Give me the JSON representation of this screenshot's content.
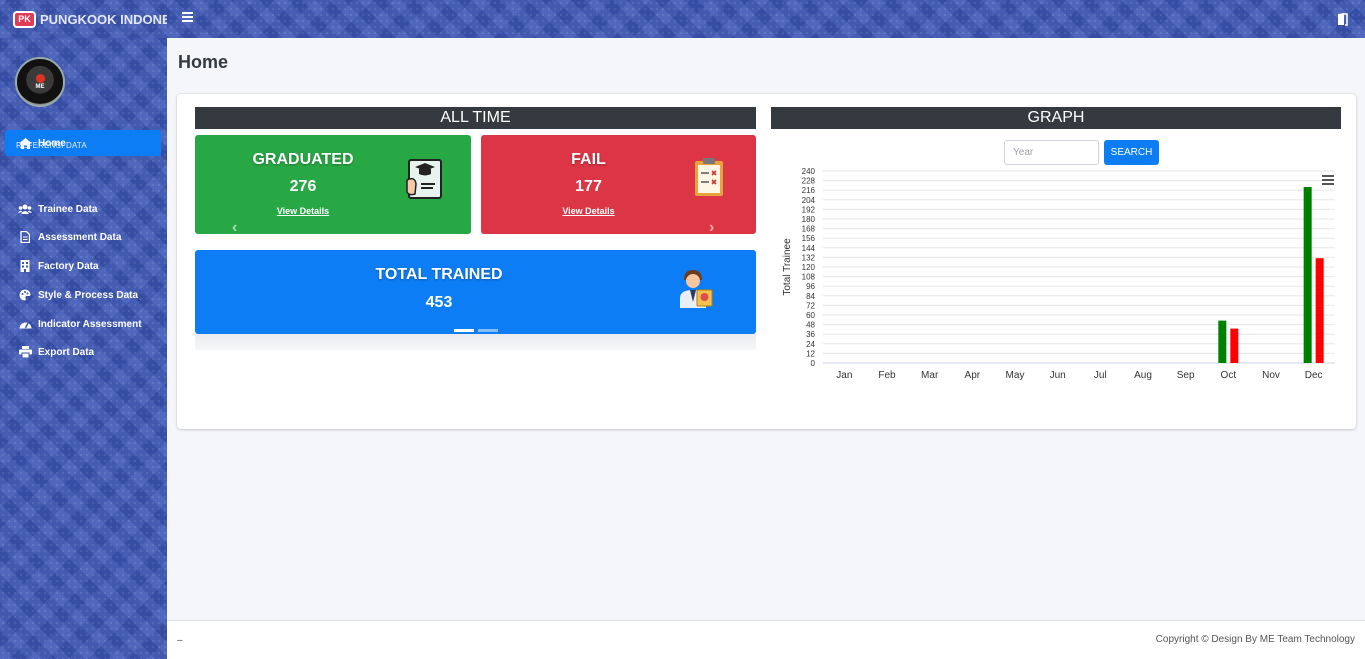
{
  "brand": {
    "logo_text": "PK",
    "name": "PUNGKOOK INDONESIA"
  },
  "avatar": {
    "text": "ME"
  },
  "sidebar": {
    "home_label": "Home",
    "section_header": "REFERENSI DATA",
    "items": [
      {
        "label": "Trainee Data",
        "icon": "users-icon"
      },
      {
        "label": "Assessment Data",
        "icon": "file-icon"
      },
      {
        "label": "Factory Data",
        "icon": "building-icon"
      },
      {
        "label": "Style & Process Data",
        "icon": "palette-icon"
      },
      {
        "label": "Indicator Assessment",
        "icon": "gauge-icon"
      },
      {
        "label": "Export Data",
        "icon": "print-icon"
      }
    ]
  },
  "page": {
    "title": "Home"
  },
  "all_time": {
    "header": "ALL TIME",
    "graduated": {
      "title": "GRADUATED",
      "value": "276",
      "link": "View Details",
      "color": "#28a745"
    },
    "fail": {
      "title": "FAIL",
      "value": "177",
      "link": "View Details",
      "color": "#dc3545"
    },
    "total": {
      "title": "TOTAL TRAINED",
      "value": "453",
      "color": "#0d7df5"
    },
    "prev_arrow": "‹",
    "next_arrow": "›"
  },
  "graph": {
    "header": "GRAPH",
    "year_placeholder": "Year",
    "search_label": "SEARCH"
  },
  "chart_data": {
    "type": "bar",
    "categories": [
      "Jan",
      "Feb",
      "Mar",
      "Apr",
      "May",
      "Jun",
      "Jul",
      "Aug",
      "Sep",
      "Oct",
      "Nov",
      "Dec"
    ],
    "series": [
      {
        "values": [
          0,
          0,
          0,
          0,
          0,
          0,
          0,
          0,
          0,
          53,
          0,
          220
        ],
        "color": "#008000"
      },
      {
        "values": [
          0,
          0,
          0,
          0,
          0,
          0,
          0,
          0,
          0,
          43,
          0,
          131
        ],
        "color": "#ff0000"
      }
    ],
    "ylabel": "Total Trainee",
    "yticks": [
      0,
      12,
      24,
      36,
      48,
      60,
      72,
      84,
      96,
      108,
      120,
      132,
      144,
      156,
      168,
      180,
      192,
      204,
      216,
      228,
      240
    ],
    "ylim": [
      0,
      240
    ],
    "grid": true
  },
  "footer": {
    "left": "–",
    "right": "Copyright © Design By ME Team Technology"
  }
}
